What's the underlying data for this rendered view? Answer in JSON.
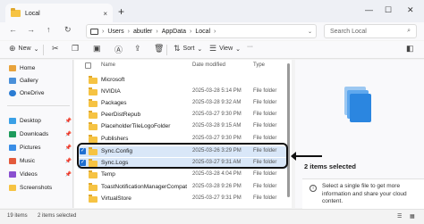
{
  "window": {
    "tab_title": "Local",
    "tab_close": "×",
    "new_tab": "+",
    "controls": [
      "—",
      "☐",
      "✕"
    ]
  },
  "address": {
    "crumbs": [
      "Users",
      "abutler",
      "AppData",
      "Local"
    ],
    "search_placeholder": "Search Local"
  },
  "commands": {
    "new": "New",
    "sort": "Sort",
    "view": "View",
    "more": "···"
  },
  "nav": {
    "items": [
      {
        "label": "Home",
        "color": "#e8a33c"
      },
      {
        "label": "Gallery",
        "color": "#4a90d9"
      },
      {
        "label": "OneDrive",
        "color": "#2b7cd3"
      },
      {
        "label": "Desktop",
        "color": "#3aa0e6"
      },
      {
        "label": "Downloads",
        "color": "#1d9b5c"
      },
      {
        "label": "Pictures",
        "color": "#3a8ee6"
      },
      {
        "label": "Music",
        "color": "#e35a3c"
      },
      {
        "label": "Videos",
        "color": "#8a4fd0"
      },
      {
        "label": "Screenshots",
        "color": "#f6c343"
      }
    ]
  },
  "columns": {
    "name": "Name",
    "date": "Date modified",
    "type": "Type"
  },
  "files": [
    {
      "name": "Microsoft",
      "date": "",
      "type": "",
      "selected": false
    },
    {
      "name": "NVIDIA",
      "date": "2025-03-28 5:14 PM",
      "type": "File folder",
      "selected": false
    },
    {
      "name": "Packages",
      "date": "2025-03-28 9:32 AM",
      "type": "File folder",
      "selected": false
    },
    {
      "name": "PeerDistRepub",
      "date": "2025-03-27 9:30 PM",
      "type": "File folder",
      "selected": false
    },
    {
      "name": "PlaceholderTileLogoFolder",
      "date": "2025-03-28 9:15 AM",
      "type": "File folder",
      "selected": false
    },
    {
      "name": "Publishers",
      "date": "2025-03-27 9:30 PM",
      "type": "File folder",
      "selected": false
    },
    {
      "name": "Sync.Config",
      "date": "2025-03-26 3:29 PM",
      "type": "File folder",
      "selected": true
    },
    {
      "name": "Sync.Logs",
      "date": "2025-03-27 9:31 AM",
      "type": "File folder",
      "selected": true
    },
    {
      "name": "Temp",
      "date": "2025-03-28 4:04 PM",
      "type": "File folder",
      "selected": false
    },
    {
      "name": "ToastNotificationManagerCompat",
      "date": "2025-03-28 9:26 PM",
      "type": "File folder",
      "selected": false
    },
    {
      "name": "VirtualStore",
      "date": "2025-03-27 9:31 PM",
      "type": "File folder",
      "selected": false
    }
  ],
  "annotation": "2 items selected",
  "details": {
    "info": "Select a single file to get more information and share your cloud content."
  },
  "status": {
    "items": "19 items",
    "selected": "2 items selected"
  }
}
